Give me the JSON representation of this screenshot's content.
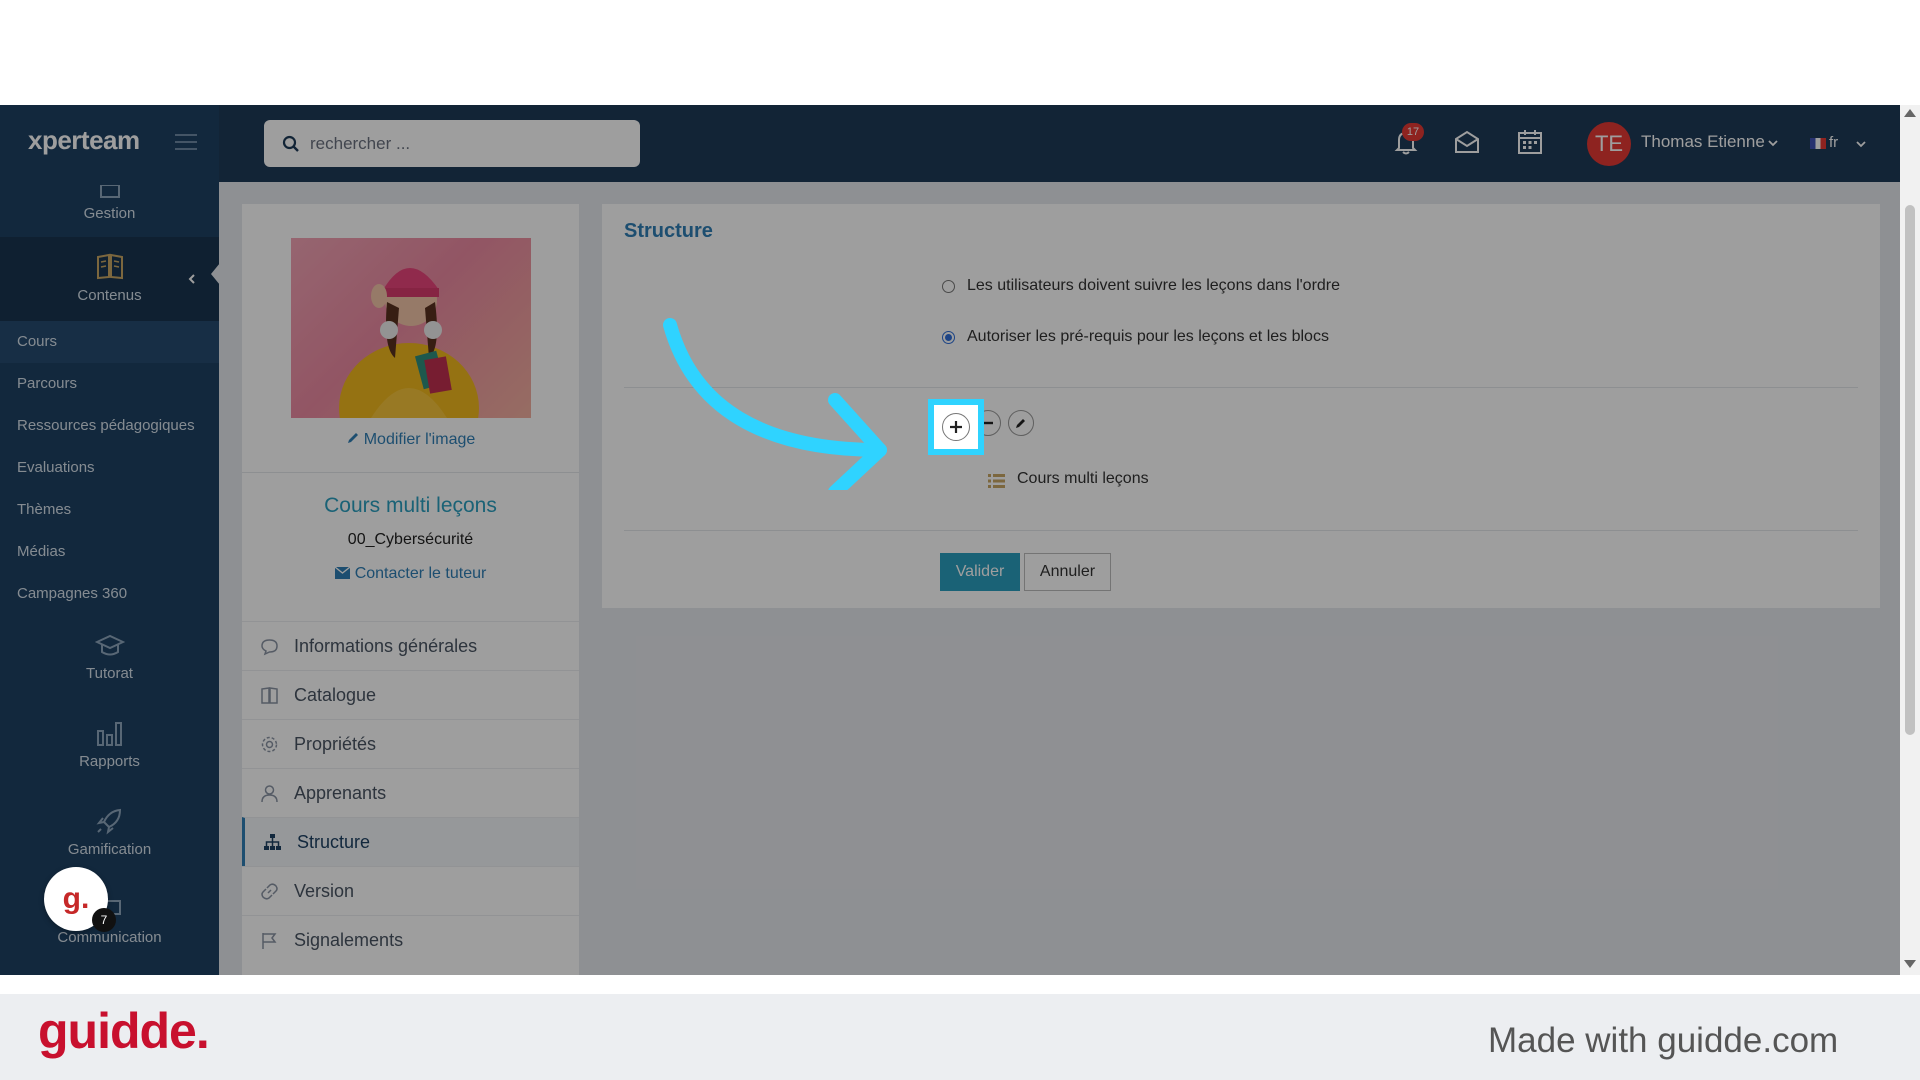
{
  "app": {
    "logo": "xperteam",
    "search_placeholder": "rechercher ...",
    "notifications_count": "17",
    "user_initials": "TE",
    "user_name": "Thomas Etienne",
    "language": "fr"
  },
  "sidebar": {
    "gestion": "Gestion",
    "contenus": "Contenus",
    "sub_items": [
      "Cours",
      "Parcours",
      "Ressources pédagogiques",
      "Evaluations",
      "Thèmes",
      "Médias",
      "Campagnes 360"
    ],
    "tutorat": "Tutorat",
    "rapports": "Rapports",
    "gamification": "Gamification",
    "communication": "Communication"
  },
  "course": {
    "modify_image": "Modifier l'image",
    "title": "Cours multi leçons",
    "code": "00_Cybersécurité",
    "contact_tutor": "Contacter le tuteur"
  },
  "course_menu": [
    "Informations générales",
    "Catalogue",
    "Propriétés",
    "Apprenants",
    "Structure",
    "Version",
    "Signalements"
  ],
  "structure": {
    "title": "Structure",
    "option_order": "Les utilisateurs doivent suivre les leçons dans l'ordre",
    "option_prereq": "Autoriser les pré-requis pour les leçons et les blocs",
    "tree_node": "Cours multi leçons",
    "validate": "Valider",
    "cancel": "Annuler"
  },
  "guidde": {
    "badge_letter": "g.",
    "badge_count": "7",
    "footer_logo": "guidde.",
    "footer_text": "Made with guidde.com"
  },
  "colors": {
    "header_bg": "#1d3a57",
    "sidebar_bg": "#1e4163",
    "accent": "#2a9fbf",
    "highlight": "#2fd3ff",
    "guidde_red": "#c8102e"
  }
}
